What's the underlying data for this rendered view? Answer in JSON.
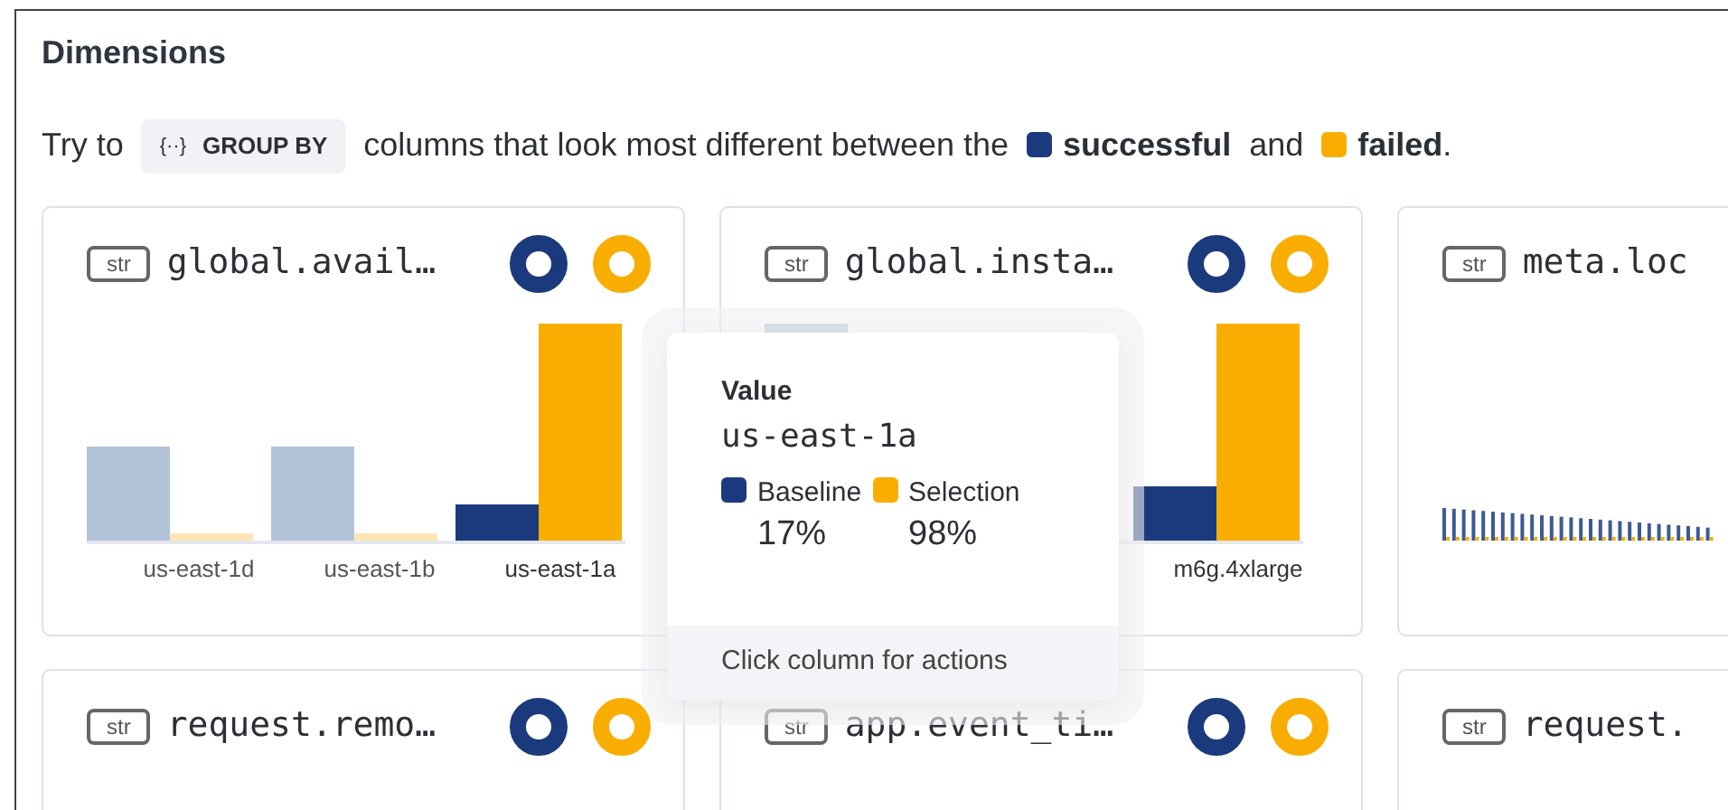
{
  "title": "Dimensions",
  "intro": [
    {
      "kind": "text",
      "text": "Try to"
    },
    {
      "kind": "chip",
      "icon": "{··}",
      "text": "GROUP BY"
    },
    {
      "kind": "text",
      "text": "columns that look most different between the"
    },
    {
      "kind": "legend",
      "color": "#1b3a7e",
      "text": "successful"
    },
    {
      "kind": "text",
      "text": "and"
    },
    {
      "kind": "legend",
      "color": "#f9ad00",
      "text": "failed"
    },
    {
      "kind": "punct",
      "text": "."
    }
  ],
  "cards": [
    {
      "type": "str",
      "name": "global.avail…",
      "rings": true,
      "kind": "bars",
      "columns": [
        {
          "label": "us-east-1d",
          "selected": false
        },
        {
          "label": "us-east-1b",
          "selected": false
        },
        {
          "label": "us-east-1a",
          "selected": true
        }
      ]
    },
    {
      "type": "str",
      "name": "global.insta…",
      "rings": true,
      "kind": "bars",
      "columns": [
        {
          "label": "m6g.4xlarge",
          "selected": true
        }
      ]
    },
    {
      "type": "str",
      "name": "meta.loc",
      "kind": "dense"
    },
    {
      "type": "str",
      "name": "request.remo…",
      "rings": true
    },
    {
      "type": "str",
      "name": "app.event_ti…",
      "rings": true
    },
    {
      "type": "str",
      "name": "request."
    }
  ],
  "tooltip": {
    "label": "Value",
    "value": "us-east-1a",
    "legend": [
      {
        "name": "Baseline",
        "color": "#1b3a7e",
        "value": "17%"
      },
      {
        "name": "Selection",
        "color": "#f9ad00",
        "value": "98%"
      }
    ],
    "footer": "Click column for actions"
  }
}
